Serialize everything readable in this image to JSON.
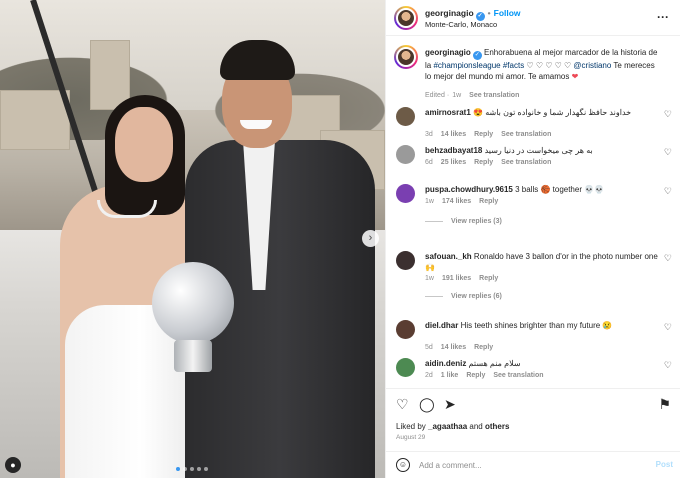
{
  "photo": {
    "next_glyph": "›",
    "tag_glyph": "●",
    "slide_count": 5,
    "active_slide": 0
  },
  "header": {
    "username": "georginagio",
    "follow": "Follow",
    "location": "Monte-Carlo, Monaco",
    "more": "···"
  },
  "caption": {
    "username": "georginagio",
    "text_pre": "Enhorabuena al mejor marcador de la historia de la ",
    "hash1": "#championsleague",
    "hash2": "#facts",
    "hearts": " ♡ ♡ ♡ ♡ ♡ ",
    "mention": "@cristiano",
    "text_post": " Te mereces lo mejor del mundo mi amor. Te amamos ",
    "heart_emoji": "❤",
    "edited": "Edited",
    "time": "1w",
    "see_translation": "See translation"
  },
  "comments": [
    {
      "username": "amirnosrat1",
      "text": "خداوند حافظ نگهدار شما و خانواده تون باشه 😍",
      "time": "3d",
      "likes": "14 likes",
      "reply": "Reply",
      "translation": "See translation",
      "rtl": true
    },
    {
      "username": "behzadbayat18",
      "text": "به هر چی میخواست در دنیا رسید",
      "time": "6d",
      "likes": "25 likes",
      "reply": "Reply",
      "translation": "See translation",
      "rtl": true
    },
    {
      "username": "puspa.chowdhury.9615",
      "text": "3 balls 🏀 together 💀💀",
      "time": "1w",
      "likes": "174 likes",
      "reply": "Reply",
      "translation": "",
      "replies": "View replies (3)"
    },
    {
      "username": "safouan._kh",
      "text": "Ronaldo have 3 ballon d'or in the photo number one🙌",
      "time": "1w",
      "likes": "191 likes",
      "reply": "Reply",
      "translation": "",
      "replies": "View replies (6)"
    },
    {
      "username": "diel.dhar",
      "text": "His teeth shines brighter than my future 😢",
      "time": "5d",
      "likes": "14 likes",
      "reply": "Reply",
      "translation": ""
    },
    {
      "username": "aidin.deniz",
      "text": "سلام منم هستم",
      "time": "2d",
      "likes": "1 like",
      "reply": "Reply",
      "translation": "See translation",
      "rtl": true
    }
  ],
  "actions": {
    "like_glyph": "♡",
    "comment_glyph": "◯",
    "share_glyph": "➤",
    "save_glyph": "⚑",
    "liked_by_prefix": "Liked by ",
    "liked_by_user": "_agaathaa",
    "liked_by_mid": " and ",
    "liked_by_others": "others",
    "date": "August 29"
  },
  "add_comment": {
    "placeholder": "Add a comment...",
    "post": "Post",
    "emoji_glyph": "☺"
  },
  "colors": {
    "accent": "#0095f6",
    "muted": "#8e8e8e",
    "text": "#262626",
    "post_disabled": "#b2dffc"
  }
}
